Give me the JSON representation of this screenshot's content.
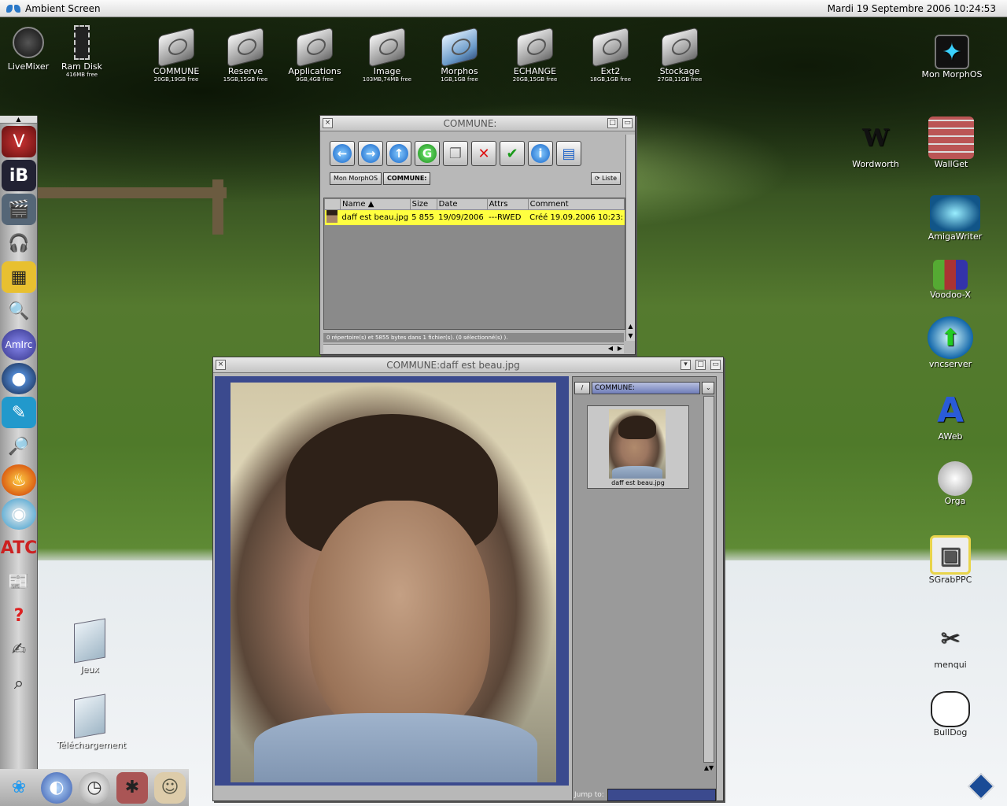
{
  "menubar": {
    "title": "Ambient Screen",
    "clock": "Mardi 19 Septembre 2006 10:24:53"
  },
  "top_icons": [
    {
      "label": "LiveMixer",
      "sub": ""
    },
    {
      "label": "Ram Disk",
      "sub": "416MB free"
    },
    {
      "label": "COMMUNE",
      "sub": "20GB,19GB free"
    },
    {
      "label": "Reserve",
      "sub": "15GB,15GB free"
    },
    {
      "label": "Applications",
      "sub": "9GB,4GB free"
    },
    {
      "label": "Image",
      "sub": "103MB,74MB free"
    },
    {
      "label": "Morphos",
      "sub": "1GB,1GB free"
    },
    {
      "label": "ECHANGE",
      "sub": "20GB,15GB free"
    },
    {
      "label": "Ext2",
      "sub": "18GB,1GB free"
    },
    {
      "label": "Stockage",
      "sub": "27GB,11GB free"
    }
  ],
  "right_icons": [
    {
      "label": "Mon MorphOS",
      "icon": "monitor-icon"
    },
    {
      "label": "Wordworth",
      "icon": "wordworth-icon"
    },
    {
      "label": "WallGet",
      "icon": "wallget-icon"
    },
    {
      "label": "AmigaWriter",
      "icon": "amigawriter-icon"
    },
    {
      "label": "Voodoo-X",
      "icon": "archive-icon"
    },
    {
      "label": "vncserver",
      "icon": "globe-monitor-icon"
    },
    {
      "label": "AWeb",
      "icon": "aweb-icon"
    },
    {
      "label": "Orga",
      "icon": "stopwatch-icon"
    },
    {
      "label": "SGrabPPC",
      "icon": "screen-grab-icon"
    },
    {
      "label": "menqui",
      "icon": "menqui-icon"
    },
    {
      "label": "BullDog",
      "icon": "bulldog-icon"
    }
  ],
  "desktop_folders": [
    {
      "label": "Jeux"
    },
    {
      "label": "Téléchargement"
    }
  ],
  "dock_items": [
    "voyager-icon",
    "ibrowse-icon",
    "movie-clapper-icon",
    "headphones-icon",
    "calendar-icon",
    "search-girl-icon",
    "amirc-icon",
    "globe-icon",
    "paint-icon",
    "magnifier-icon",
    "fire-icon",
    "cd-icon",
    "atc-icon",
    "reader-icon",
    "help-icon",
    "notepad-icon",
    "magnify-icon"
  ],
  "bottom_dock": [
    "butterfly-icon",
    "morphos-icon",
    "stopwatch-icon",
    "spider-icon",
    "mascot-icon"
  ],
  "file_window": {
    "title": "COMMUNE:",
    "toolbar": [
      "back-icon",
      "forward-icon",
      "up-icon",
      "refresh-icon",
      "copy-icon",
      "delete-icon",
      "check-icon",
      "info-icon",
      "new-drawer-icon"
    ],
    "path": [
      "Mon MorphOS",
      "COMMUNE:"
    ],
    "view_button": "Liste",
    "columns": [
      "Name",
      "Size",
      "Date",
      "Attrs",
      "Comment"
    ],
    "rows": [
      {
        "name": "daff est beau.jpg",
        "size": "5 855",
        "date": "19/09/2006",
        "attrs": "---RWED",
        "comment": "Créé 19.09.2006 10:23:"
      }
    ],
    "status": "0 répertoire(s) et 5855 bytes dans 1 fichier(s). (0 sélectionné(s) )."
  },
  "viewer_window": {
    "title": "COMMUNE:daff est beau.jpg",
    "path_button": "/",
    "path": "COMMUNE:",
    "thumb_label": "daff est beau.jpg",
    "jump_label": "Jump to:",
    "jump_value": ""
  }
}
